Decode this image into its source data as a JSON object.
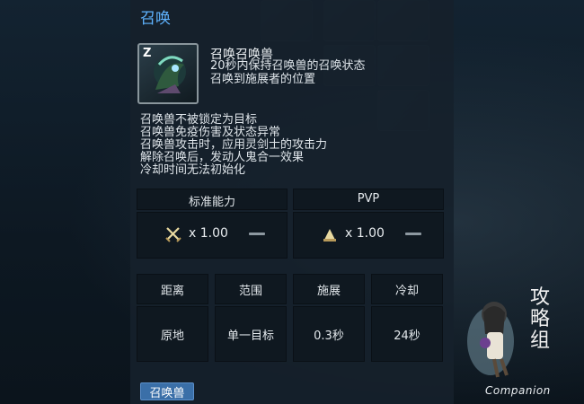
{
  "title": "召唤",
  "skill": {
    "key": "Z",
    "name": "召唤召唤兽",
    "lines": [
      "20秒内保持召唤兽的召唤状态",
      "召唤到施展者的位置"
    ]
  },
  "description": [
    "召唤兽不被锁定为目标",
    "召唤兽免疫伤害及状态异常",
    "召唤兽攻击时，应用灵剑士的攻击力",
    "解除召唤后，发动人鬼合一效果",
    "冷却时间无法初始化"
  ],
  "stats": {
    "standard": {
      "header": "标准能力",
      "multiplier": "x 1.00",
      "icon": "crossed-swords-icon"
    },
    "pvp": {
      "header": "PVP",
      "multiplier": "x 1.00",
      "icon": "pvp-helmet-icon"
    }
  },
  "details": {
    "headers": [
      "距离",
      "范围",
      "施展",
      "冷却"
    ],
    "values": [
      "原地",
      "单一目标",
      "0.3秒",
      "24秒"
    ]
  },
  "tag_button": "召唤兽",
  "watermark": {
    "text": "Companion",
    "calligraphy": [
      "攻",
      "略",
      "组"
    ]
  },
  "colors": {
    "title": "#5fb3ff",
    "tag_button": "#3a6fa8"
  }
}
